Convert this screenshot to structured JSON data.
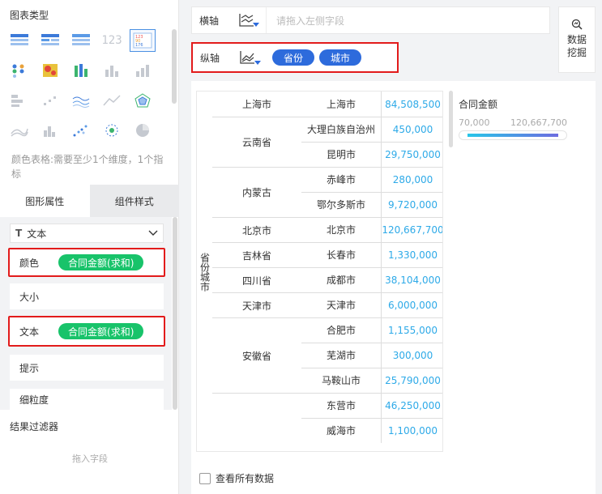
{
  "left_panel": {
    "chart_type_title": "图表类型",
    "chart_types": [
      {
        "icon": "table-icon"
      },
      {
        "icon": "grouped-table-icon"
      },
      {
        "icon": "cross-table-icon"
      },
      {
        "icon": "kpi-number-icon",
        "text": "123"
      },
      {
        "icon": "color-table-icon",
        "selected": true
      },
      {
        "icon": "dot-matrix-icon"
      },
      {
        "icon": "heatmap-icon"
      },
      {
        "icon": "stacked-bar-icon"
      },
      {
        "icon": "bar-chart-icon"
      },
      {
        "icon": "column-chart-icon"
      },
      {
        "icon": "horizontal-bar-icon"
      },
      {
        "icon": "scatter-small-icon"
      },
      {
        "icon": "wave-line-icon"
      },
      {
        "icon": "line-area-icon"
      },
      {
        "icon": "radar-icon"
      },
      {
        "icon": "multi-line-icon"
      },
      {
        "icon": "histogram-icon"
      },
      {
        "icon": "scatter-icon"
      },
      {
        "icon": "bubble-icon"
      },
      {
        "icon": "pie-chart-icon"
      }
    ],
    "chart_hint": "颜色表格:需要至少1个维度，1个指标",
    "tabs": {
      "shape": "图形属性",
      "style": "组件样式"
    },
    "text_dropdown": "文本",
    "props": {
      "color_label": "颜色",
      "color_field": "合同金额(求和)",
      "size_label": "大小",
      "text_label": "文本",
      "text_field": "合同金额(求和)",
      "tip_label": "提示",
      "granularity_label": "细粒度"
    },
    "filter_title": "结果过滤器",
    "filter_placeholder": "拖入字段"
  },
  "x_axis": {
    "label": "横轴",
    "placeholder": "请拖入左侧字段"
  },
  "y_axis": {
    "label": "纵轴",
    "fields": [
      "省份",
      "城市"
    ]
  },
  "data_mining": "数据挖掘",
  "table": {
    "row_header": "省份城市",
    "groups": [
      {
        "province": "上海市",
        "rows": [
          {
            "city": "上海市",
            "value": "84,508,500"
          }
        ]
      },
      {
        "province": "云南省",
        "rows": [
          {
            "city": "大理白族自治州",
            "value": "450,000"
          },
          {
            "city": "昆明市",
            "value": "29,750,000"
          }
        ]
      },
      {
        "province": "内蒙古",
        "rows": [
          {
            "city": "赤峰市",
            "value": "280,000"
          },
          {
            "city": "鄂尔多斯市",
            "value": "9,720,000"
          }
        ]
      },
      {
        "province": "北京市",
        "rows": [
          {
            "city": "北京市",
            "value": "120,667,700"
          }
        ]
      },
      {
        "province": "吉林省",
        "rows": [
          {
            "city": "长春市",
            "value": "1,330,000"
          }
        ]
      },
      {
        "province": "四川省",
        "rows": [
          {
            "city": "成都市",
            "value": "38,104,000"
          }
        ]
      },
      {
        "province": "天津市",
        "rows": [
          {
            "city": "天津市",
            "value": "6,000,000"
          }
        ]
      },
      {
        "province": "安徽省",
        "rows": [
          {
            "city": "合肥市",
            "value": "1,155,000"
          },
          {
            "city": "芜湖市",
            "value": "300,000"
          },
          {
            "city": "马鞍山市",
            "value": "25,790,000"
          }
        ]
      },
      {
        "province": "",
        "rows": [
          {
            "city": "东营市",
            "value": "46,250,000"
          },
          {
            "city": "威海市",
            "value": "1,100,000"
          }
        ]
      }
    ]
  },
  "legend": {
    "title": "合同金额",
    "min": "70,000",
    "max": "120,667,700",
    "colors": [
      "#28c6e8",
      "#6e6ce0"
    ]
  },
  "view_all": "查看所有数据"
}
